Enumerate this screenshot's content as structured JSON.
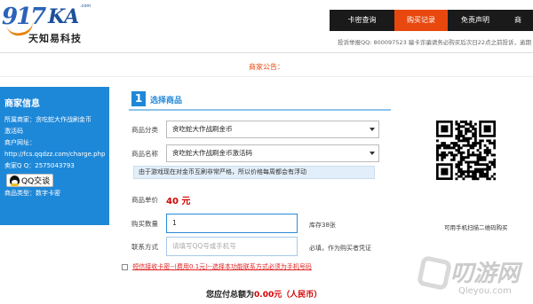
{
  "logo": {
    "brand": "917KA",
    "domain": ".com",
    "name_cn": "天知易科技"
  },
  "nav": {
    "items": [
      "卡密查询",
      "购买记录",
      "免责声明",
      "商"
    ],
    "active": "购买记录"
  },
  "complaint": "投诉举报QQ: 800097523  骗卡诈骗请务必购买后次日22点之前投诉，逾期",
  "notice": "商家公告：",
  "merchant": {
    "title": "商家信息",
    "store_line1": "所属商家：贪吃蛇大作战刷金币",
    "store_line2": "激活码",
    "url_label": "商户网址：",
    "url": "http://fcs.qqdzz.com/charge.php",
    "qq": "卖家Q Q：2575043793",
    "qq_button": "QQ交谈",
    "type": "商品类型：数字卡密"
  },
  "section": {
    "number": "1",
    "title": "选择商品"
  },
  "form": {
    "category_label": "商品分类",
    "category_value": "贪吃蛇大作战刷金币",
    "name_label": "商品名称",
    "name_value": "贪吃蛇大作战刷金币激活码",
    "hint": "由于游戏现在对金币互刷非常严格，所以价格每周都会有浮动",
    "price_label": "商品单价",
    "price": "40 元",
    "qty_label": "购买数量",
    "qty_value": "1",
    "stock": "库存38张",
    "contact_label": "联系方式",
    "contact_placeholder": "请填写QQ号或手机号",
    "contact_note": "必填，作为购买者凭证"
  },
  "sms": {
    "text": "短信接收卡密--(费用0.1元)--选择本功能联系方式必须为手机号码"
  },
  "total": {
    "prefix": "您应付总额为",
    "amount": "0.00",
    "unit_text": "元（人民币）"
  },
  "qr": {
    "caption": "可用手机扫描二维码购买"
  },
  "watermark": {
    "text": "叨游网",
    "url": "Qleyou.com"
  },
  "colors": {
    "accent": "#1e88d8",
    "nav_active": "#e8480e",
    "price": "#d40000"
  }
}
